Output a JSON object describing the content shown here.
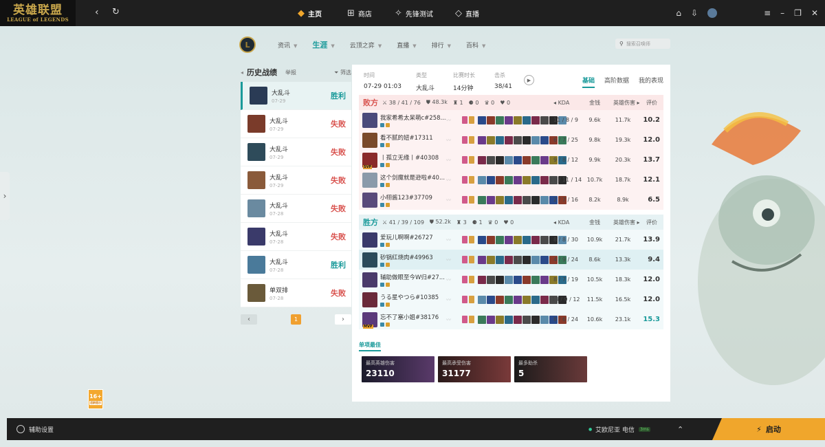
{
  "app": {
    "logo_cn": "英雄联盟",
    "logo_en": "LEAGUE of LEGENDS"
  },
  "topnav": [
    {
      "label": "主页",
      "icon": "home-icon"
    },
    {
      "label": "商店",
      "icon": "store-icon"
    },
    {
      "label": "先锋测试",
      "icon": "test-icon"
    },
    {
      "label": "直播",
      "icon": "live-icon"
    }
  ],
  "secnav": {
    "items": [
      "资讯",
      "生涯",
      "云顶之弈",
      "直播",
      "排行",
      "百科"
    ],
    "active": "生涯",
    "search_placeholder": "搜索召唤师"
  },
  "history": {
    "title": "历史战绩",
    "report": "举报",
    "filter": "筛选",
    "matches": [
      {
        "mode": "大乱斗",
        "date": "07-29",
        "result": "胜利",
        "color": "#2a3b55"
      },
      {
        "mode": "大乱斗",
        "date": "07-29",
        "result": "失败",
        "color": "#7a3b2a"
      },
      {
        "mode": "大乱斗",
        "date": "07-29",
        "result": "失败",
        "color": "#2e4b5a"
      },
      {
        "mode": "大乱斗",
        "date": "07-29",
        "result": "失败",
        "color": "#8a5a3a"
      },
      {
        "mode": "大乱斗",
        "date": "07-28",
        "result": "失败",
        "color": "#6a8aa0"
      },
      {
        "mode": "大乱斗",
        "date": "07-28",
        "result": "失败",
        "color": "#3a3a6a"
      },
      {
        "mode": "大乱斗",
        "date": "07-28",
        "result": "胜利",
        "color": "#4a7a9a"
      },
      {
        "mode": "单双排",
        "date": "07-28",
        "result": "失败",
        "color": "#6a5a3a"
      }
    ],
    "page": "1"
  },
  "match_info": {
    "time_label": "时间",
    "time": "07-29 01:03",
    "type_label": "类型",
    "type": "大乱斗",
    "dur_label": "比赛时长",
    "dur": "14分钟",
    "kills_label": "击杀",
    "kills": "38/41"
  },
  "tabs": [
    "基础",
    "高阶数据",
    "我的表现"
  ],
  "columns": {
    "kda": "KDA",
    "gold": "金钱",
    "dmg": "英雄伤害",
    "score": "评价"
  },
  "lose_team": {
    "name": "败方",
    "stats": [
      "38 / 41 / 76",
      "48.3k",
      "1",
      "0",
      "0",
      "0"
    ],
    "players": [
      {
        "name": "我家希希太呆萌c#258...",
        "kda": "11 / 8 / 9",
        "gold": "9.6k",
        "dmg": "11.7k",
        "score": "10.2",
        "color": "#4a4a7a"
      },
      {
        "name": "看不腻的妞#17311",
        "kda": "6 / 7 / 25",
        "gold": "9.8k",
        "dmg": "19.3k",
        "score": "12.0",
        "color": "#7a4a2a"
      },
      {
        "name": "丨孤立无缘丨#40308",
        "kda": "9 / 8 / 12",
        "gold": "9.9k",
        "dmg": "20.3k",
        "score": "13.7",
        "color": "#8a2a2a",
        "badge": "SVP"
      },
      {
        "name": "这个剑魔就是逊啦#40...",
        "kda": "10 / 11 / 14",
        "gold": "10.7k",
        "dmg": "18.7k",
        "score": "12.1",
        "color": "#8a9aaa"
      },
      {
        "name": "小栩酱123#37709",
        "kda": "2 / 7 / 16",
        "gold": "8.2k",
        "dmg": "8.9k",
        "score": "6.5",
        "color": "#5a4a7a"
      }
    ]
  },
  "win_team": {
    "name": "胜方",
    "stats": [
      "41 / 39 / 109",
      "52.2k",
      "3",
      "1",
      "0",
      "0"
    ],
    "players": [
      {
        "name": "爱玩儿啊啊#26727",
        "kda": "8 / 8 / 30",
        "gold": "10.9k",
        "dmg": "21.7k",
        "score": "13.9",
        "color": "#3a3a6a"
      },
      {
        "name": "砂锅红烧肉#49963",
        "kda": "4 / 9 / 24",
        "gold": "8.6k",
        "dmg": "13.3k",
        "score": "9.4",
        "color": "#2a4a5a"
      },
      {
        "name": "辅助做眼至今W归#27...",
        "kda": "8 / 7 / 19",
        "gold": "10.5k",
        "dmg": "18.3k",
        "score": "12.0",
        "color": "#4a3a6a"
      },
      {
        "name": "うる星やつら#10385",
        "kda": "13 / 9 / 12",
        "gold": "11.5k",
        "dmg": "16.5k",
        "score": "12.0",
        "color": "#6a2a3a"
      },
      {
        "name": "忘不了塞小姐#38176",
        "kda": "8 / 6 / 24",
        "gold": "10.6k",
        "dmg": "23.1k",
        "score": "15.3",
        "color": "#5a3a7a",
        "badge": "MVP"
      }
    ]
  },
  "best": {
    "title": "单项最佳",
    "cards": [
      {
        "label": "最高英雄伤害",
        "value": "23110"
      },
      {
        "label": "最高承受伤害",
        "value": "31177"
      },
      {
        "label": "最多助杀",
        "value": "5"
      }
    ]
  },
  "age": {
    "rating": "16+",
    "label": "适龄提示"
  },
  "bottom": {
    "assist": "辅助设置",
    "server": "艾欧尼亚 电信",
    "ping": "3ms",
    "start": "启动"
  }
}
